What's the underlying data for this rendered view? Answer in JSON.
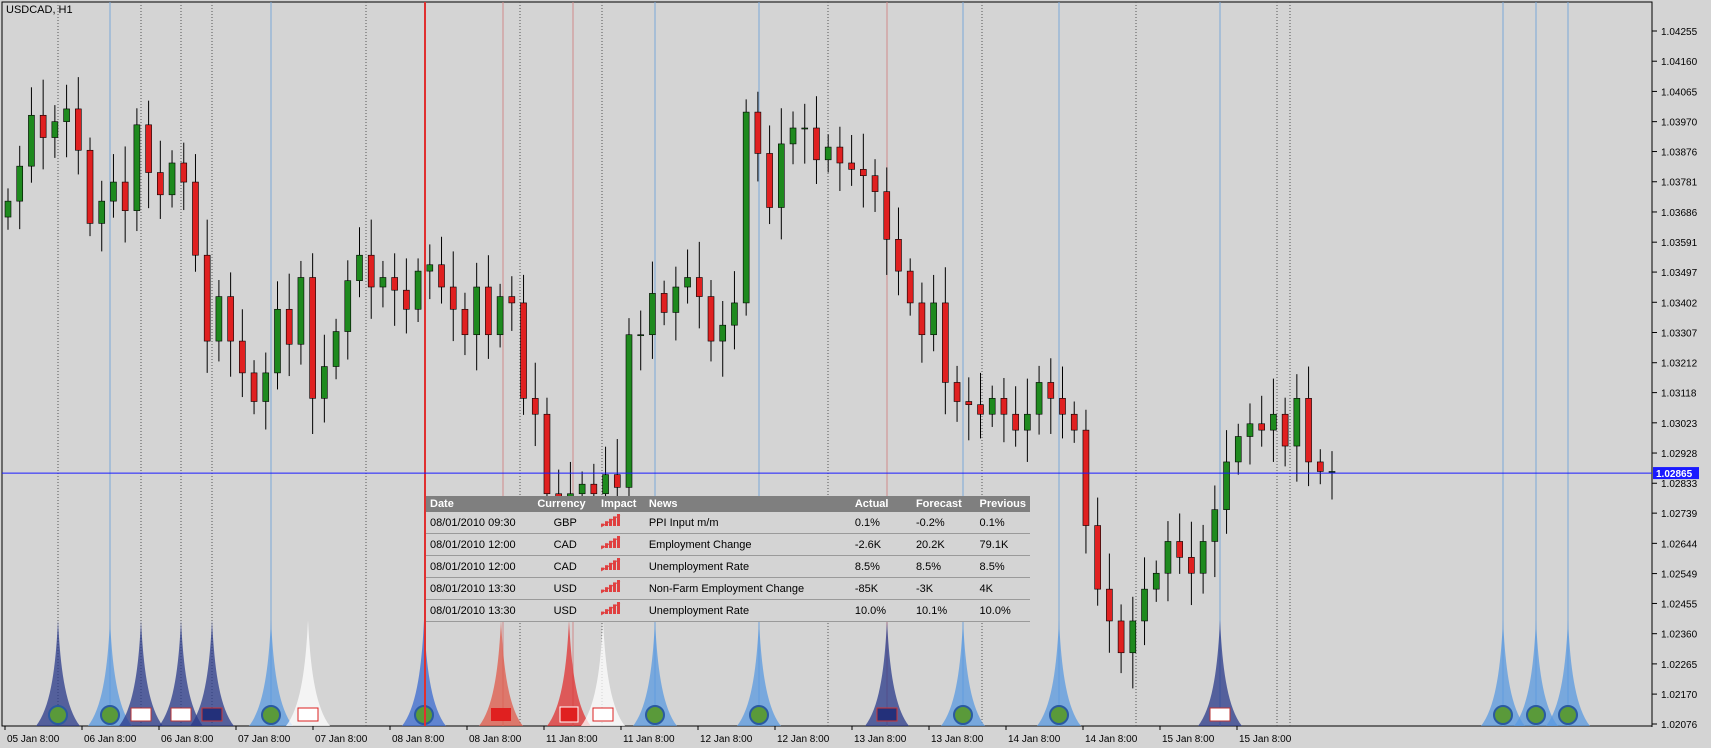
{
  "chart_title": "USDCAD, H1",
  "current_price": "1.02865",
  "colors": {
    "background": "#d4d4d4",
    "bull_candle": "#1e8a1e",
    "bear_candle": "#e02020",
    "price_line": "#1a1aff",
    "event_line": "#e03030",
    "axis": "#000000"
  },
  "chart_data": {
    "type": "candlestick",
    "symbol": "USDCAD",
    "timeframe": "H1",
    "y_ticks": [
      "1.04255",
      "1.04160",
      "1.04065",
      "1.03970",
      "1.03876",
      "1.03781",
      "1.03686",
      "1.03591",
      "1.03497",
      "1.03402",
      "1.03307",
      "1.03212",
      "1.03118",
      "1.03023",
      "1.02928",
      "1.02833",
      "1.02739",
      "1.02644",
      "1.02549",
      "1.02455",
      "1.02360",
      "1.02265",
      "1.02170",
      "1.02076"
    ],
    "ylim": [
      1.02076,
      1.04255
    ],
    "x_ticks": [
      "05 Jan 8:00",
      "06 Jan 8:00",
      "06 Jan 8:00",
      "07 Jan 8:00",
      "07 Jan 8:00",
      "08 Jan 8:00",
      "08 Jan 8:00",
      "11 Jan 8:00",
      "11 Jan 8:00",
      "12 Jan 8:00",
      "12 Jan 8:00",
      "13 Jan 8:00",
      "13 Jan 8:00",
      "14 Jan 8:00",
      "14 Jan 8:00",
      "15 Jan 8:00",
      "15 Jan 8:00"
    ],
    "close_path": [
      1.0372,
      1.0383,
      1.0399,
      1.0392,
      1.0397,
      1.0401,
      1.0388,
      1.0365,
      1.0372,
      1.0378,
      1.0369,
      1.0396,
      1.0381,
      1.0374,
      1.0384,
      1.0378,
      1.0355,
      1.0328,
      1.0342,
      1.0328,
      1.0318,
      1.0309,
      1.0318,
      1.0338,
      1.0327,
      1.0348,
      1.031,
      1.032,
      1.0331,
      1.0347,
      1.0355,
      1.0345,
      1.0348,
      1.0344,
      1.0338,
      1.035,
      1.0352,
      1.0345,
      1.0338,
      1.033,
      1.0345,
      1.033,
      1.0342,
      1.034,
      1.031,
      1.0305,
      1.028,
      1.0265,
      1.028,
      1.0283,
      1.028,
      1.0286,
      1.0282,
      1.033,
      1.033,
      1.0343,
      1.0337,
      1.0345,
      1.0348,
      1.0342,
      1.0328,
      1.0333,
      1.034,
      1.04,
      1.0387,
      1.037,
      1.039,
      1.0395,
      1.0395,
      1.0385,
      1.0389,
      1.0384,
      1.0382,
      1.038,
      1.0375,
      1.036,
      1.035,
      1.034,
      1.033,
      1.034,
      1.0315,
      1.0309,
      1.0308,
      1.0305,
      1.031,
      1.0305,
      1.03,
      1.0305,
      1.0315,
      1.031,
      1.0305,
      1.03,
      1.027,
      1.025,
      1.024,
      1.023,
      1.024,
      1.025,
      1.0255,
      1.0265,
      1.026,
      1.0255,
      1.0265,
      1.0275,
      1.029,
      1.0298,
      1.0302,
      1.03,
      1.0305,
      1.0295,
      1.031,
      1.029,
      1.0287,
      1.0287
    ],
    "current_price": 1.02865
  },
  "event_markers": [
    {
      "flag": "globe",
      "color": "#2a3a8a"
    },
    {
      "flag": "globe",
      "color": "#5a9ae0"
    },
    {
      "flag": "usa",
      "color": "#2a3a8a"
    },
    {
      "flag": "usa",
      "color": "#2a3a8a"
    },
    {
      "flag": "aus",
      "color": "#2a3a8a"
    },
    {
      "flag": "globe",
      "color": "#5a9ae0"
    },
    {
      "flag": "canada",
      "color": "#ffffff"
    },
    {
      "flag": "globe",
      "color": "#3a6ad0"
    },
    {
      "flag": "china",
      "color": "#e05a4a"
    },
    {
      "flag": "swiss",
      "color": "#e03030"
    },
    {
      "flag": "canada",
      "color": "#ffffff"
    },
    {
      "flag": "globe",
      "color": "#5a9ae0"
    },
    {
      "flag": "globe",
      "color": "#5a9ae0"
    },
    {
      "flag": "uk",
      "color": "#2a3a8a"
    },
    {
      "flag": "globe",
      "color": "#5a9ae0"
    },
    {
      "flag": "globe",
      "color": "#5a9ae0"
    },
    {
      "flag": "usa",
      "color": "#2a3a8a"
    },
    {
      "flag": "globe",
      "color": "#5a9ae0"
    },
    {
      "flag": "globe",
      "color": "#5a9ae0"
    },
    {
      "flag": "globe",
      "color": "#5a9ae0"
    }
  ],
  "news": {
    "headers": {
      "date": "Date",
      "currency": "Currency",
      "impact": "Impact",
      "news": "News",
      "actual": "Actual",
      "forecast": "Forecast",
      "previous": "Previous"
    },
    "rows": [
      {
        "date": "08/01/2010 09:30",
        "currency": "GBP",
        "news": "PPI Input m/m",
        "actual": "0.1%",
        "forecast": "-0.2%",
        "previous": "0.1%",
        "actual_tone": "pos"
      },
      {
        "date": "08/01/2010 12:00",
        "currency": "CAD",
        "news": "Employment Change",
        "actual": "-2.6K",
        "forecast": "20.2K",
        "previous": "79.1K",
        "actual_tone": "neg"
      },
      {
        "date": "08/01/2010 12:00",
        "currency": "CAD",
        "news": "Unemployment Rate",
        "actual": "8.5%",
        "forecast": "8.5%",
        "previous": "8.5%",
        "actual_tone": "neutral"
      },
      {
        "date": "08/01/2010 13:30",
        "currency": "USD",
        "news": "Non-Farm Employment Change",
        "actual": "-85K",
        "forecast": "-3K",
        "previous": "4K",
        "actual_tone": "neg"
      },
      {
        "date": "08/01/2010 13:30",
        "currency": "USD",
        "news": "Unemployment Rate",
        "actual": "10.0%",
        "forecast": "10.1%",
        "previous": "10.0%",
        "actual_tone": "pos"
      }
    ]
  }
}
